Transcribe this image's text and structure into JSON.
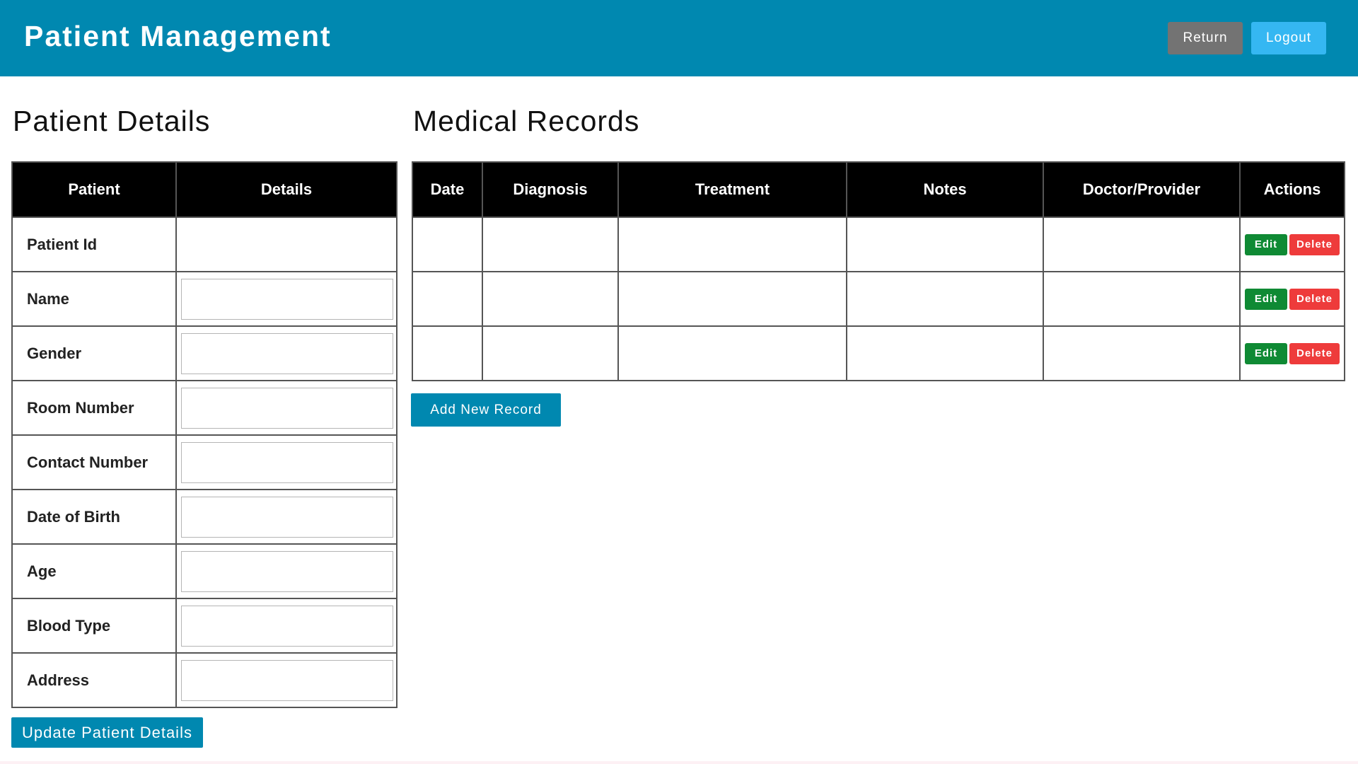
{
  "header": {
    "title": "Patient Management",
    "return_label": "Return",
    "logout_label": "Logout"
  },
  "patient_details": {
    "title": "Patient Details",
    "columns": [
      "Patient",
      "Details"
    ],
    "fields": [
      {
        "label": "Patient Id",
        "value": "",
        "editable": false
      },
      {
        "label": "Name",
        "value": "",
        "editable": true
      },
      {
        "label": "Gender",
        "value": "",
        "editable": true
      },
      {
        "label": "Room Number",
        "value": "",
        "editable": true
      },
      {
        "label": "Contact Number",
        "value": "",
        "editable": true
      },
      {
        "label": "Date of Birth",
        "value": "",
        "editable": true
      },
      {
        "label": "Age",
        "value": "",
        "editable": true
      },
      {
        "label": "Blood Type",
        "value": "",
        "editable": true
      },
      {
        "label": "Address",
        "value": "",
        "editable": true
      }
    ],
    "update_label": "Update Patient Details"
  },
  "medical_records": {
    "title": "Medical Records",
    "columns": [
      "Date",
      "Diagnosis",
      "Treatment",
      "Notes",
      "Doctor/Provider",
      "Actions"
    ],
    "rows": [
      {
        "date": "",
        "diagnosis": "",
        "treatment": "",
        "notes": "",
        "doctor": ""
      },
      {
        "date": "",
        "diagnosis": "",
        "treatment": "",
        "notes": "",
        "doctor": ""
      },
      {
        "date": "",
        "diagnosis": "",
        "treatment": "",
        "notes": "",
        "doctor": ""
      }
    ],
    "edit_label": "Edit",
    "delete_label": "Delete",
    "add_label": "Add New Record"
  },
  "colors": {
    "header_bg": "#0088b0",
    "return_bg": "#737373",
    "logout_bg": "#35b7f2",
    "edit_bg": "#0f8a34",
    "delete_bg": "#ee3b3b",
    "table_header_bg": "#000000"
  }
}
